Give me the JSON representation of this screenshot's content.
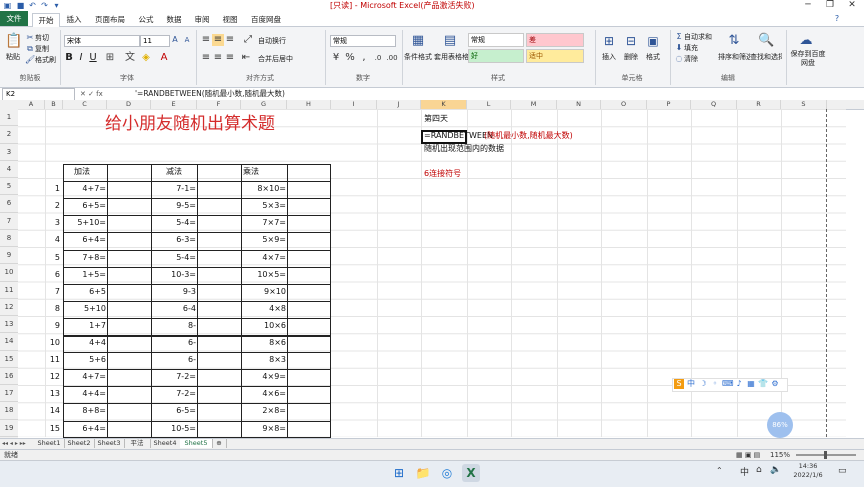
{
  "window": {
    "title": "[只读] - Microsoft Excel(产品激活失败)",
    "quick_access": [
      "save-icon",
      "undo-icon",
      "redo-icon",
      "customize-icon"
    ]
  },
  "ribbon_tabs": [
    "文件",
    "开始",
    "插入",
    "页面布局",
    "公式",
    "数据",
    "审阅",
    "视图",
    "百度网盘"
  ],
  "ribbon": {
    "clipboard": {
      "paste": "粘贴",
      "cut": "剪切",
      "copy": "复制",
      "format_painter": "格式刷",
      "group": "剪贴板"
    },
    "font": {
      "name": "宋体",
      "size": "11",
      "group": "字体"
    },
    "alignment": {
      "wrap": "自动换行",
      "merge": "合并后居中",
      "group": "对齐方式"
    },
    "number": {
      "format": "常规",
      "group": "数字"
    },
    "styles": {
      "conditional": "条件格式",
      "table": "套用表格格式",
      "normal": "常规",
      "bad": "差",
      "good": "好",
      "neutral": "适中",
      "group": "样式"
    },
    "cells": {
      "insert": "插入",
      "delete": "删除",
      "format": "格式",
      "group": "单元格"
    },
    "editing": {
      "autosum": "自动求和",
      "fill": "填充",
      "clear": "清除",
      "sort": "排序和筛选",
      "find": "查找和选择",
      "group": "编辑"
    },
    "save_cloud": "保存到百度网盘"
  },
  "formula_bar": {
    "name_box": "K2",
    "formula": "'=RANDBETWEEN(随机最小数,随机最大数)"
  },
  "columns": [
    "A",
    "B",
    "C",
    "D",
    "E",
    "F",
    "G",
    "H",
    "I",
    "J",
    "K",
    "L",
    "M",
    "N",
    "O",
    "P",
    "Q",
    "R",
    "S"
  ],
  "rows": [
    "1",
    "2",
    "3",
    "4",
    "5",
    "6",
    "7",
    "8",
    "9",
    "10",
    "11",
    "12",
    "13",
    "14",
    "15",
    "16",
    "17",
    "18",
    "19",
    "20"
  ],
  "sheet": {
    "title": "给小朋友随机出算术题",
    "headers": {
      "add": "加法",
      "sub": "减法",
      "mul": "乘法"
    },
    "items": [
      {
        "n": "1",
        "add": "4+7=",
        "sub": "7-1=",
        "mul": "8×10="
      },
      {
        "n": "2",
        "add": "6+5=",
        "sub": "9-5=",
        "mul": "5×3="
      },
      {
        "n": "3",
        "add": "5+10=",
        "sub": "5-4=",
        "mul": "7×7="
      },
      {
        "n": "4",
        "add": "6+4=",
        "sub": "6-3=",
        "mul": "5×9="
      },
      {
        "n": "5",
        "add": "7+8=",
        "sub": "5-4=",
        "mul": "4×7="
      },
      {
        "n": "6",
        "add": "1+5=",
        "sub": "10-3=",
        "mul": "10×5="
      },
      {
        "n": "7",
        "add": "6+5",
        "sub": "9-3",
        "mul": "9×10"
      },
      {
        "n": "8",
        "add": "5+10",
        "sub": "6-4",
        "mul": "4×8"
      },
      {
        "n": "9",
        "add": "1+7",
        "sub": "8-",
        "mul": "10×6"
      },
      {
        "n": "10",
        "add": "4+4",
        "sub": "6-",
        "mul": "8×6"
      },
      {
        "n": "11",
        "add": "5+6",
        "sub": "6-",
        "mul": "8×3"
      },
      {
        "n": "12",
        "add": "4+7=",
        "sub": "7-2=",
        "mul": "4×9="
      },
      {
        "n": "13",
        "add": "4+4=",
        "sub": "7-2=",
        "mul": "4×6="
      },
      {
        "n": "14",
        "add": "8+8=",
        "sub": "6-5=",
        "mul": "2×8="
      },
      {
        "n": "15",
        "add": "6+4=",
        "sub": "10-5=",
        "mul": "9×8="
      }
    ],
    "notes": {
      "lesson": "第四天",
      "formula_prefix": "=RANDBETWEEN",
      "formula_args": "(随机最小数,随机最大数)",
      "explain": "随机出现范围内的数据",
      "step": "6连接符号"
    }
  },
  "sheet_tabs": [
    "Sheet1",
    "Sheet2",
    "Sheet3",
    "平法",
    "Sheet4",
    "Sheet5"
  ],
  "status": {
    "mode": "就绪",
    "zoom": "115%"
  },
  "taskbar": {
    "time": "14:36",
    "date": "2022/1/6",
    "ime": "中"
  },
  "float_widget": {
    "label": "86%"
  }
}
